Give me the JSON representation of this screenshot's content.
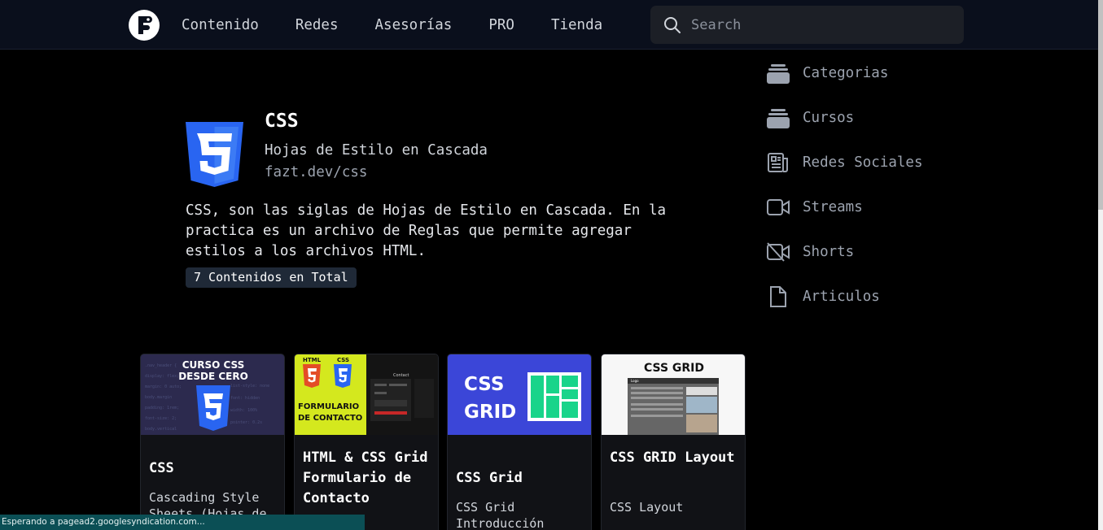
{
  "header": {
    "nav": [
      "Contenido",
      "Redes",
      "Asesorías",
      "PRO",
      "Tienda"
    ],
    "search_placeholder": "Search"
  },
  "hero": {
    "title": "CSS",
    "subtitle": "Hojas de Estilo en Cascada",
    "url": "fazt.dev/css",
    "description": "CSS, son las siglas de Hojas de Estilo en Cascada. En la practica es un archivo de Reglas que permite agregar estilos a los archivos HTML.",
    "count": "7 Contenidos en Total"
  },
  "sidebar": {
    "items": [
      {
        "label": "Categorias",
        "icon": "stack-icon"
      },
      {
        "label": "Cursos",
        "icon": "stack-icon"
      },
      {
        "label": "Redes Sociales",
        "icon": "newspaper-icon"
      },
      {
        "label": "Streams",
        "icon": "video-icon"
      },
      {
        "label": "Shorts",
        "icon": "video-off-icon"
      },
      {
        "label": "Articulos",
        "icon": "document-icon"
      }
    ]
  },
  "cards": [
    {
      "title": "CSS",
      "subtitle": "Cascading Style Sheets (Hojas de",
      "thumb_text": [
        "CURSO CSS",
        "DESDE CERO"
      ]
    },
    {
      "title": "HTML & CSS Grid Formulario de Contacto",
      "subtitle": "",
      "thumb_text": [
        "FORMULARIO",
        "DE CONTACTO",
        "Contact"
      ]
    },
    {
      "title": "CSS Grid",
      "subtitle": "CSS Grid Introducción",
      "thumb_text": [
        "CSS",
        "GRID"
      ]
    },
    {
      "title": "CSS GRID Layout",
      "subtitle": "CSS Layout",
      "thumb_text": [
        "CSS GRID",
        "Logo"
      ]
    }
  ],
  "status_bar": "Esperando a pagead2.googlesyndication.com...",
  "colors": {
    "css_blue": "#2965f1",
    "header_bg": "#0a0f1c",
    "card_bg": "#111216"
  }
}
